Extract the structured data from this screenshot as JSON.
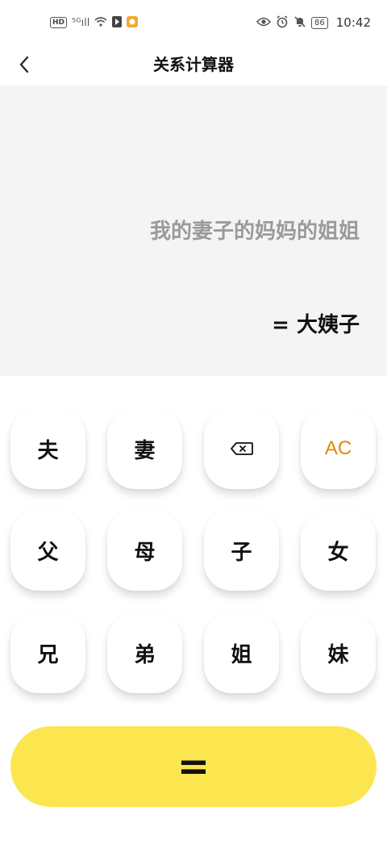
{
  "status_bar": {
    "hd": "HD",
    "signal": "⁵ᴳıll",
    "time": "10:42",
    "battery": "86"
  },
  "app_bar": {
    "title": "关系计算器"
  },
  "display": {
    "expression": "我的妻子的妈妈的姐姐",
    "result": "= 大姨子"
  },
  "keypad": {
    "row1": [
      "夫",
      "妻",
      "",
      "AC"
    ],
    "row2": [
      "父",
      "母",
      "子",
      "女"
    ],
    "row3": [
      "兄",
      "弟",
      "姐",
      "妹"
    ],
    "equals_label": "="
  },
  "colors": {
    "accent_yellow": "#fce650",
    "ac_orange": "#e08a00",
    "display_bg": "#f4f4f4"
  }
}
